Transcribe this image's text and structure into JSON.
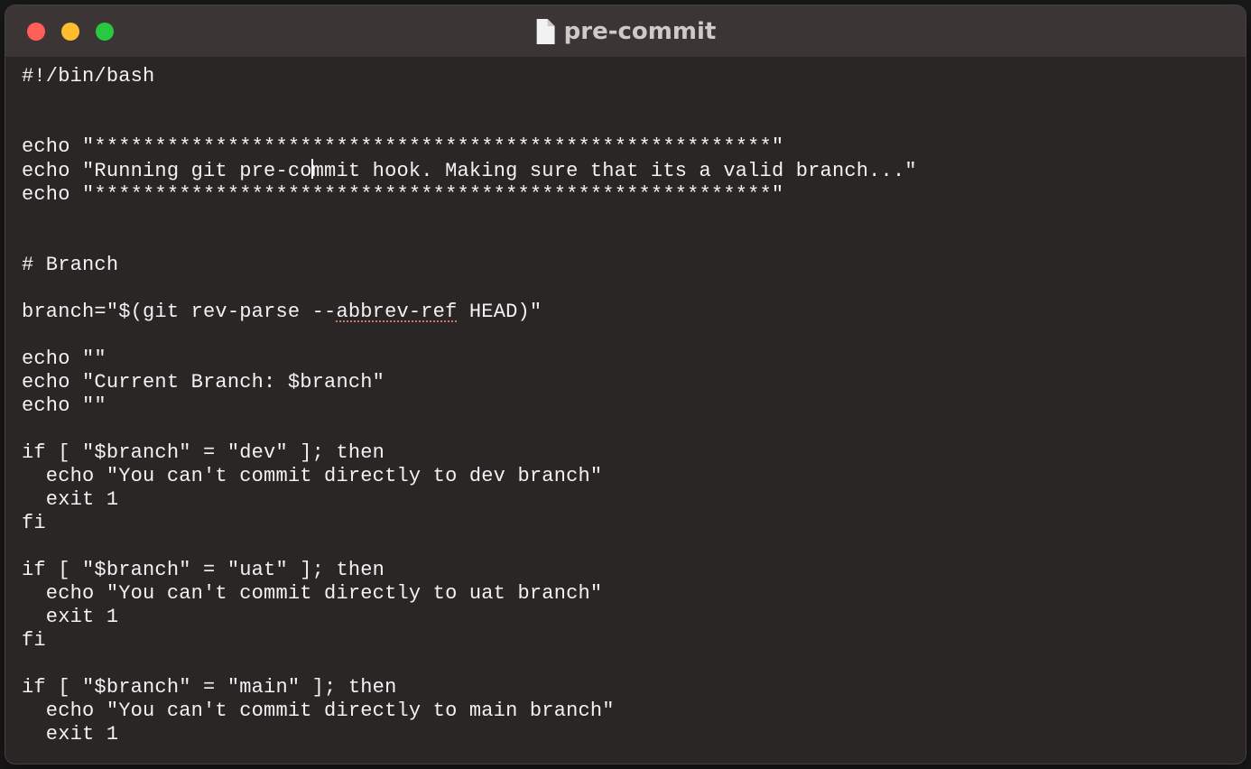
{
  "window": {
    "title": "pre-commit"
  },
  "code": {
    "l01": "#!/bin/bash",
    "l02": "",
    "l03": "",
    "l04": "echo \"********************************************************\"",
    "l05a": "echo \"Running git pre-co",
    "l05b": "mmit hook. Making sure that its a valid branch...\"",
    "l06": "echo \"********************************************************\"",
    "l07": "",
    "l08": "",
    "l09": "# Branch",
    "l10": "",
    "l11a": "branch=\"$(git rev-parse --",
    "l11b": "abbrev-ref",
    "l11c": " HEAD)\"",
    "l12": "",
    "l13": "echo \"\"",
    "l14": "echo \"Current Branch: $branch\"",
    "l15": "echo \"\"",
    "l16": "",
    "l17": "if [ \"$branch\" = \"dev\" ]; then",
    "l18": "  echo \"You can't commit directly to dev branch\"",
    "l19": "  exit 1",
    "l20": "fi",
    "l21": "",
    "l22": "if [ \"$branch\" = \"uat\" ]; then",
    "l23": "  echo \"You can't commit directly to uat branch\"",
    "l24": "  exit 1",
    "l25": "fi",
    "l26": "",
    "l27": "if [ \"$branch\" = \"main\" ]; then",
    "l28": "  echo \"You can't commit directly to main branch\"",
    "l29": "  exit 1"
  }
}
